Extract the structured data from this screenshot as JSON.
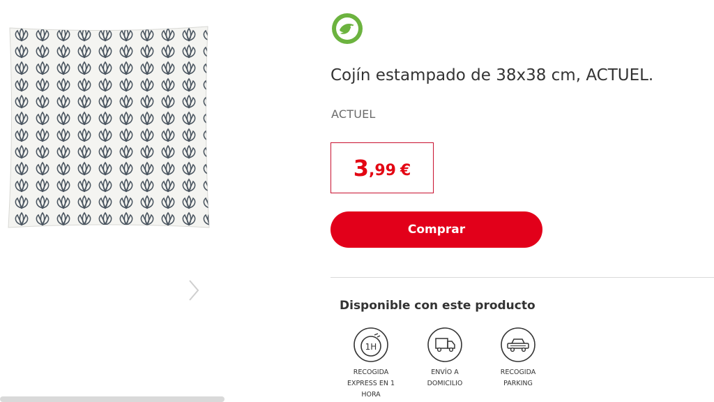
{
  "product": {
    "title": "Cojín estampado de 38x38 cm, ACTUEL.",
    "brand": "ACTUEL",
    "image_icon": "cushion-pattern-image",
    "logo_icon": "bird-logo-icon"
  },
  "price": {
    "integer": "3",
    "decimal": ",99",
    "currency": "€"
  },
  "buy_button": {
    "label": "Comprar"
  },
  "availability": {
    "title": "Disponible con este producto",
    "options": [
      {
        "icon": "express-1h-icon",
        "label_lines": [
          "RECOGIDA",
          "EXPRESS EN 1",
          "HORA"
        ]
      },
      {
        "icon": "delivery-truck-icon",
        "label_lines": [
          "ENVÍO A",
          "DOMICILIO"
        ]
      },
      {
        "icon": "car-parking-icon",
        "label_lines": [
          "RECOGIDA",
          "PARKING"
        ]
      }
    ]
  },
  "colors": {
    "accent_red": "#e2001a",
    "logo_green": "#6cb33f",
    "text_dark": "#333333",
    "text_muted": "#6b6b6b"
  }
}
